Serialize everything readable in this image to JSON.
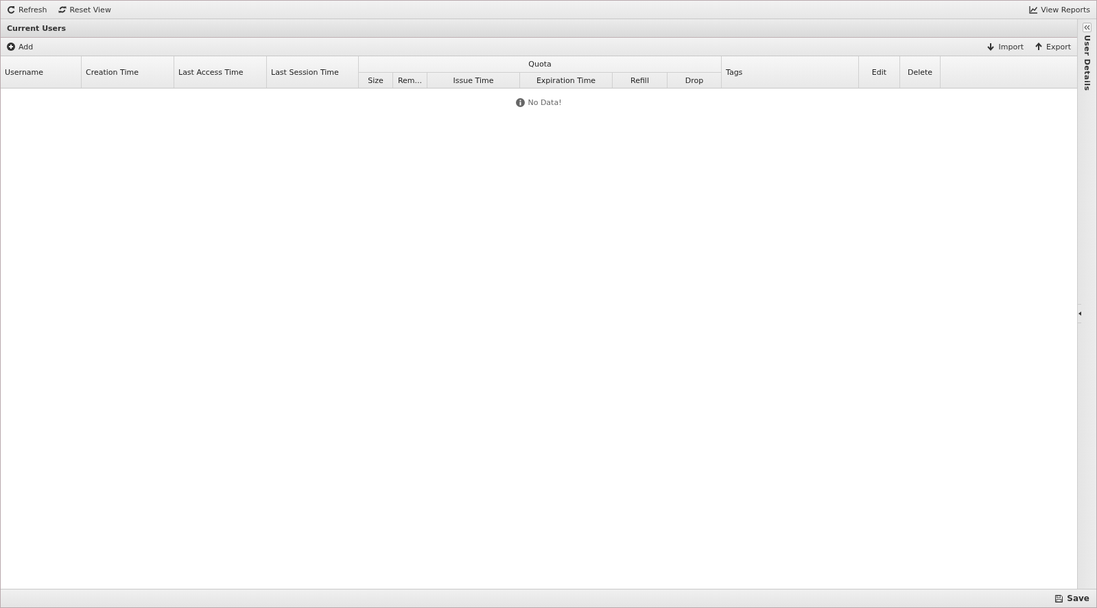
{
  "toolbar": {
    "left": [
      {
        "label": "Refresh",
        "kind": "refresh"
      },
      {
        "label": "Reset View",
        "kind": "sync"
      }
    ],
    "right": [
      {
        "label": "View Reports",
        "kind": "chart"
      }
    ]
  },
  "panel": {
    "title": "Current Users",
    "actions": {
      "left": [
        {
          "label": "Add",
          "kind": "plus"
        }
      ],
      "right": [
        {
          "label": "Import",
          "kind": "down"
        },
        {
          "label": "Export",
          "kind": "up"
        }
      ]
    },
    "table": {
      "columns": [
        {
          "label": "Username",
          "kind": "text"
        },
        {
          "label": "Creation Time",
          "kind": "text"
        },
        {
          "label": "Last Access Time",
          "kind": "text"
        },
        {
          "label": "Last Session Time",
          "kind": "text"
        },
        {
          "label": "Quota",
          "kind": "group",
          "children": [
            {
              "label": "Size"
            },
            {
              "label": "Rem..."
            },
            {
              "label": "Issue Time"
            },
            {
              "label": "Expiration Time"
            },
            {
              "label": "Refill"
            },
            {
              "label": "Drop"
            }
          ]
        },
        {
          "label": "Tags",
          "kind": "text"
        },
        {
          "label": "Edit",
          "kind": "action"
        },
        {
          "label": "Delete",
          "kind": "action"
        }
      ],
      "empty_message": "No Data!"
    },
    "footer": {
      "button": "Save"
    }
  },
  "side_panel": {
    "title": "User Details",
    "expanded": false
  }
}
